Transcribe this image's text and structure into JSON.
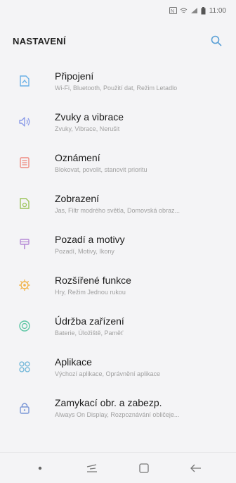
{
  "status_bar": {
    "time": "11:00"
  },
  "header": {
    "title": "NASTAVENÍ",
    "search_icon": "search-icon"
  },
  "settings_items": [
    {
      "title": "Připojení",
      "subtitle": "Wi-Fi, Bluetooth, Použití dat, Režim Letadlo",
      "icon": "connections-icon",
      "color": "#6ab0e6"
    },
    {
      "title": "Zvuky a vibrace",
      "subtitle": "Zvuky, Vibrace, Nerušit",
      "icon": "sound-icon",
      "color": "#8a9be8"
    },
    {
      "title": "Oznámení",
      "subtitle": "Blokovat, povolit, stanovit prioritu",
      "icon": "notifications-icon",
      "color": "#ef8a80"
    },
    {
      "title": "Zobrazení",
      "subtitle": "Jas, Filtr modrého světla, Domovská obraz...",
      "icon": "display-icon",
      "color": "#9bc45a"
    },
    {
      "title": "Pozadí a motivy",
      "subtitle": "Pozadí, Motivy, Ikony",
      "icon": "wallpaper-icon",
      "color": "#b58ad6"
    },
    {
      "title": "Rozšířené funkce",
      "subtitle": "Hry, Režim Jednou rukou",
      "icon": "advanced-features-icon",
      "color": "#f2b44a"
    },
    {
      "title": "Údržba zařízení",
      "subtitle": "Baterie, Úložiště, Paměť",
      "icon": "device-maintenance-icon",
      "color": "#5cc6a4"
    },
    {
      "title": "Aplikace",
      "subtitle": "Výchozí aplikace, Oprávnění aplikace",
      "icon": "apps-icon",
      "color": "#6fb6d8"
    },
    {
      "title": "Zamykací obr. a zabezp.",
      "subtitle": "Always On Display, Rozpoznávání obličeje...",
      "icon": "lock-screen-icon",
      "color": "#7a96d6"
    }
  ],
  "nav_bar": {
    "buttons": [
      "dot-icon",
      "recent-apps-icon",
      "home-icon",
      "back-icon"
    ]
  },
  "colors": {
    "background": "#f4f4f6",
    "accent": "#5aa0d6"
  }
}
